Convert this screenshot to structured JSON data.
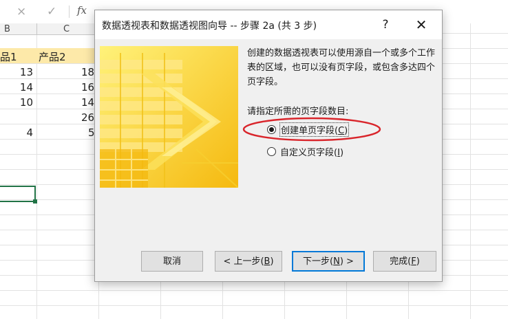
{
  "formula_bar": {
    "cancel_icon": "×",
    "enter_icon": "✓",
    "fx_label": "fx"
  },
  "sheet": {
    "columns": [
      "B",
      "C"
    ],
    "header_row": [
      "品1",
      "产品2"
    ],
    "col_b_values": [
      "13",
      "14",
      "10",
      "",
      "4"
    ],
    "col_c_values": [
      "18",
      "16",
      "14",
      "26",
      "5"
    ],
    "header_fill": "#fde9a9"
  },
  "dialog": {
    "title": "数据透视表和数据透视图向导 -- 步骤 2a (共 3 步)",
    "help_label": "?",
    "close_label": "✕",
    "description": "创建的数据透视表可以使用源自一个或多个工作表的区域，也可以没有页字段，或包含多达四个页字段。",
    "prompt": "请指定所需的页字段数目:",
    "options": [
      {
        "label": "创建单页字段",
        "accel": "C",
        "checked": true
      },
      {
        "label": "自定义页字段",
        "accel": "I",
        "checked": false
      }
    ],
    "buttons": {
      "cancel": "取消",
      "back_prefix": "< 上一步(",
      "back_accel": "B",
      "back_suffix": ")",
      "next_prefix": "下一步(",
      "next_accel": "N",
      "next_suffix": ") >",
      "finish_prefix": "完成(",
      "finish_accel": "F",
      "finish_suffix": ")"
    },
    "colors": {
      "graphic_yellow": "#fcd62a",
      "annotation_red": "#d9252b",
      "default_button_border": "#0078d7"
    }
  }
}
